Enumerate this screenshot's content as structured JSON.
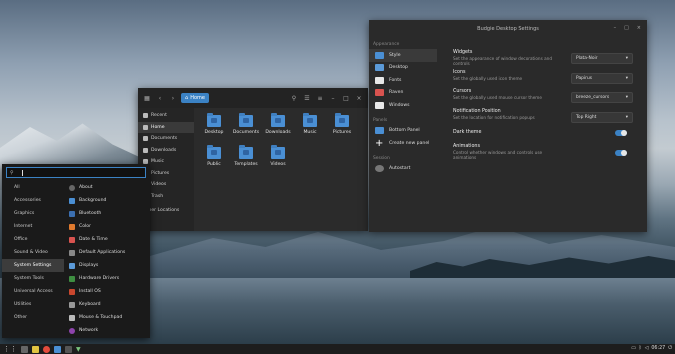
{
  "file_manager": {
    "crumb": "Home",
    "sidebar": [
      "Recent",
      "Home",
      "Documents",
      "Downloads",
      "Music",
      "Pictures",
      "Videos",
      "Trash",
      "Other Locations"
    ],
    "files": [
      "Desktop",
      "Documents",
      "Downloads",
      "Music",
      "Pictures",
      "Public",
      "Templates",
      "Videos"
    ]
  },
  "budgie_settings": {
    "title": "Budgie Desktop Settings",
    "sections": {
      "appearance": "Appearance",
      "panels": "Panels",
      "session": "Session"
    },
    "appearance_items": [
      "Style",
      "Desktop",
      "Fonts",
      "Raven",
      "Windows"
    ],
    "panel_items": [
      "Bottom Panel",
      "Create new panel"
    ],
    "session_items": [
      "Autostart"
    ],
    "rows": [
      {
        "title": "Widgets",
        "desc": "Set the appearance of window decorations and controls",
        "value": "Plata-Noir"
      },
      {
        "title": "Icons",
        "desc": "Set the globally used icon theme",
        "value": "Papirus"
      },
      {
        "title": "Cursors",
        "desc": "Set the globally used mouse cursor theme",
        "value": "breeze_cursors"
      },
      {
        "title": "Notification Position",
        "desc": "Set the location for notification popups",
        "value": "Top Right"
      },
      {
        "title": "Dark theme",
        "desc": ""
      },
      {
        "title": "Animations",
        "desc": "Control whether windows and controls use animations"
      }
    ]
  },
  "app_menu": {
    "search_value": "",
    "categories": [
      "All",
      "Accessories",
      "Graphics",
      "Internet",
      "Office",
      "Sound & Video",
      "System Settings",
      "System Tools",
      "Universal Access",
      "Utilities",
      "Other"
    ],
    "active_category": "System Settings",
    "apps": [
      "About",
      "Background",
      "Bluetooth",
      "Color",
      "Date & Time",
      "Default Applications",
      "Displays",
      "Hardware Drivers",
      "Install OS",
      "Keyboard",
      "Mouse & Touchpad",
      "Network"
    ]
  },
  "panel": {
    "clock": "06:27"
  }
}
